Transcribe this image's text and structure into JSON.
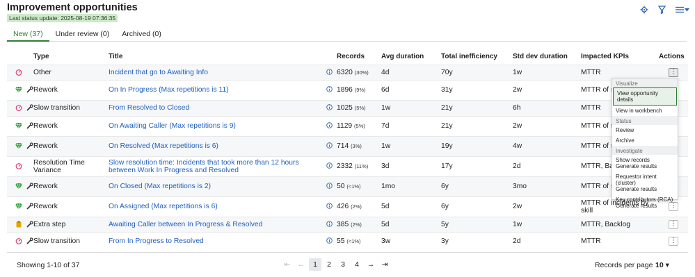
{
  "header": {
    "title": "Improvement opportunities",
    "status_badge": "Last status update: 2025-08-19 07:36:35",
    "icons": [
      "settings-icon",
      "filter-icon",
      "list-menu-icon"
    ]
  },
  "tabs": [
    {
      "label": "New (37)",
      "active": true
    },
    {
      "label": "Under review (0)",
      "active": false
    },
    {
      "label": "Archived (0)",
      "active": false
    }
  ],
  "table": {
    "columns": [
      "Type",
      "Title",
      "Records",
      "Avg duration",
      "Total inefficiency",
      "Std dev duration",
      "Impacted KPIs",
      "Actions"
    ],
    "rows": [
      {
        "type": "Other",
        "title": "Incident that go to Awaiting Info",
        "records": "6320",
        "pct": "(30%)",
        "avg": "4d",
        "total": "70y",
        "std": "1w",
        "kpi": "MTTR",
        "icons": [
          "gauge-icon"
        ]
      },
      {
        "type": "Rework",
        "title": "On In Progress (Max repetitions is 11)",
        "records": "1896",
        "pct": "(9%)",
        "avg": "6d",
        "total": "31y",
        "std": "2w",
        "kpi": "MTTR of skill",
        "icons": [
          "gem-icon",
          "wrench-icon"
        ]
      },
      {
        "type": "Slow transition",
        "title": "From Resolved to Closed",
        "records": "1025",
        "pct": "(5%)",
        "avg": "1w",
        "total": "21y",
        "std": "6h",
        "kpi": "MTTR",
        "icons": [
          "gauge-icon",
          "wrench-icon"
        ]
      },
      {
        "type": "Rework",
        "title": "On Awaiting Caller (Max repetitions is 9)",
        "records": "1129",
        "pct": "(5%)",
        "avg": "7d",
        "total": "21y",
        "std": "2w",
        "kpi": "MTTR of skill",
        "icons": [
          "gem-icon",
          "wrench-icon"
        ]
      },
      {
        "type": "Rework",
        "title": "On Resolved (Max repetitions is 6)",
        "records": "714",
        "pct": "(3%)",
        "avg": "1w",
        "total": "19y",
        "std": "4w",
        "kpi": "MTTR of skill",
        "icons": [
          "gem-icon",
          "wrench-icon"
        ]
      },
      {
        "type": "Resolution Time Variance",
        "title": "Slow resolution time: Incidents that took more than 12 hours between Work In Progress and Resolved",
        "records": "2332",
        "pct": "(11%)",
        "avg": "3d",
        "total": "17y",
        "std": "2d",
        "kpi": "MTTR, Bac",
        "icons": [
          "gauge-icon"
        ]
      },
      {
        "type": "Rework",
        "title": "On Closed (Max repetitions is 2)",
        "records": "50",
        "pct": "(<1%)",
        "avg": "1mo",
        "total": "6y",
        "std": "3mo",
        "kpi": "MTTR of skill",
        "icons": [
          "gem-icon",
          "wrench-icon"
        ]
      },
      {
        "type": "Rework",
        "title": "On Assigned (Max repetitions is 6)",
        "records": "426",
        "pct": "(2%)",
        "avg": "5d",
        "total": "6y",
        "std": "2w",
        "kpi": "MTTR of incidents by skill",
        "icons": [
          "gem-icon",
          "wrench-icon"
        ]
      },
      {
        "type": "Extra step",
        "title": "Awaiting Caller between In Progress & Resolved",
        "records": "385",
        "pct": "(2%)",
        "avg": "5d",
        "total": "5y",
        "std": "1w",
        "kpi": "MTTR, Backlog",
        "icons": [
          "clipboard-icon",
          "wrench-icon"
        ]
      },
      {
        "type": "Slow transition",
        "title": "From In Progress to Resolved",
        "records": "55",
        "pct": "(<1%)",
        "avg": "3w",
        "total": "3y",
        "std": "2d",
        "kpi": "MTTR",
        "icons": [
          "gauge-icon",
          "wrench-icon"
        ]
      }
    ]
  },
  "menu": {
    "sections": [
      {
        "header": "Visualize",
        "items": [
          {
            "label": "View opportunity details",
            "selected": true
          },
          {
            "label": "View in workbench"
          }
        ]
      },
      {
        "header": "Status",
        "items": [
          {
            "label": "Review"
          },
          {
            "label": "Archive"
          }
        ]
      },
      {
        "header": "Investigate",
        "items": [
          {
            "label": "Show records",
            "sub": "Generate results"
          },
          {
            "label": "Requestor intent (cluster)",
            "sub": "Generate results"
          },
          {
            "label": "Key contributors (RCA)",
            "sub": "Generate results"
          }
        ]
      }
    ]
  },
  "footer": {
    "showing": "Showing 1-10 of 37",
    "pages": [
      "1",
      "2",
      "3",
      "4"
    ],
    "current_page": "1",
    "records_per_page_label": "Records per page",
    "records_per_page_value": "10"
  },
  "colors": {
    "accent": "#2e7d32",
    "link": "#1f5fbf",
    "gauge": "#d6336c",
    "gem": "#2e9e3a",
    "clipboard": "#e0a800"
  }
}
